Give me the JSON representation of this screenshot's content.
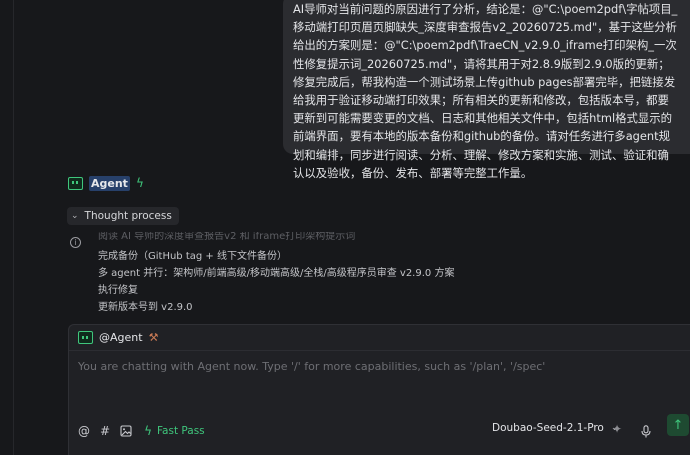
{
  "user_message": {
    "text": "AI导师对当前问题的原因进行了分析，结论是：@\"C:\\poem2pdf\\字帖项目_移动端打印页眉页脚缺失_深度审查报告v2_20260725.md\"，基于这些分析给出的方案则是：@\"C:\\poem2pdf\\TraeCN_v2.9.0_iframe打印架构_一次性修复提示词_20260725.md\"，请将其用于对2.8.9版到2.9.0版的更新；修复完成后，帮我构造一个测试场景上传github pages部署完毕，把链接发给我用于验证移动端打印效果；所有相关的更新和修改，包括版本号，都要更新到可能需要变更的文档、日志和其他相关文件中，包括html格式显示的前端界面，要有本地的版本备份和github的备份。请对任务进行多agent规划和编排，同步进行阅读、分析、理解、修改方案和实施、测试、验证和确认以及验收，备份、发布、部署等完整工作量。"
  },
  "agent": {
    "name": "Agent",
    "thought_label": "Thought process"
  },
  "steps": [
    "阅读 AI 导师的深度审查报告v2 和 iframe打印架构提示词",
    "完成备份（GitHub tag + 线下文件备份）",
    "多 agent 并行：架构师/前端高级/移动端高级/全栈/高级程序员审查 v2.9.0 方案",
    "执行修复",
    "更新版本号到 v2.9.0"
  ],
  "composer": {
    "mention": "@Agent",
    "placeholder": "You are chatting with Agent now. Type '/' for more capabilities, such as '/plan', '/spec'",
    "fast_pass_label": "Fast Pass",
    "model": "Doubao-Seed-2.1-Pro"
  },
  "colors": {
    "accent_green": "#3fc67c",
    "bubble_bg": "#2b2c30",
    "panel_bg": "#202125",
    "highlight_blue": "#27406a"
  },
  "icons": [
    "agent-icon",
    "bolt-icon",
    "chevron-down-icon",
    "info-icon",
    "tool-icon",
    "at-icon",
    "hash-icon",
    "image-icon",
    "sparkle-icon",
    "mic-icon",
    "send-arrow-icon"
  ]
}
